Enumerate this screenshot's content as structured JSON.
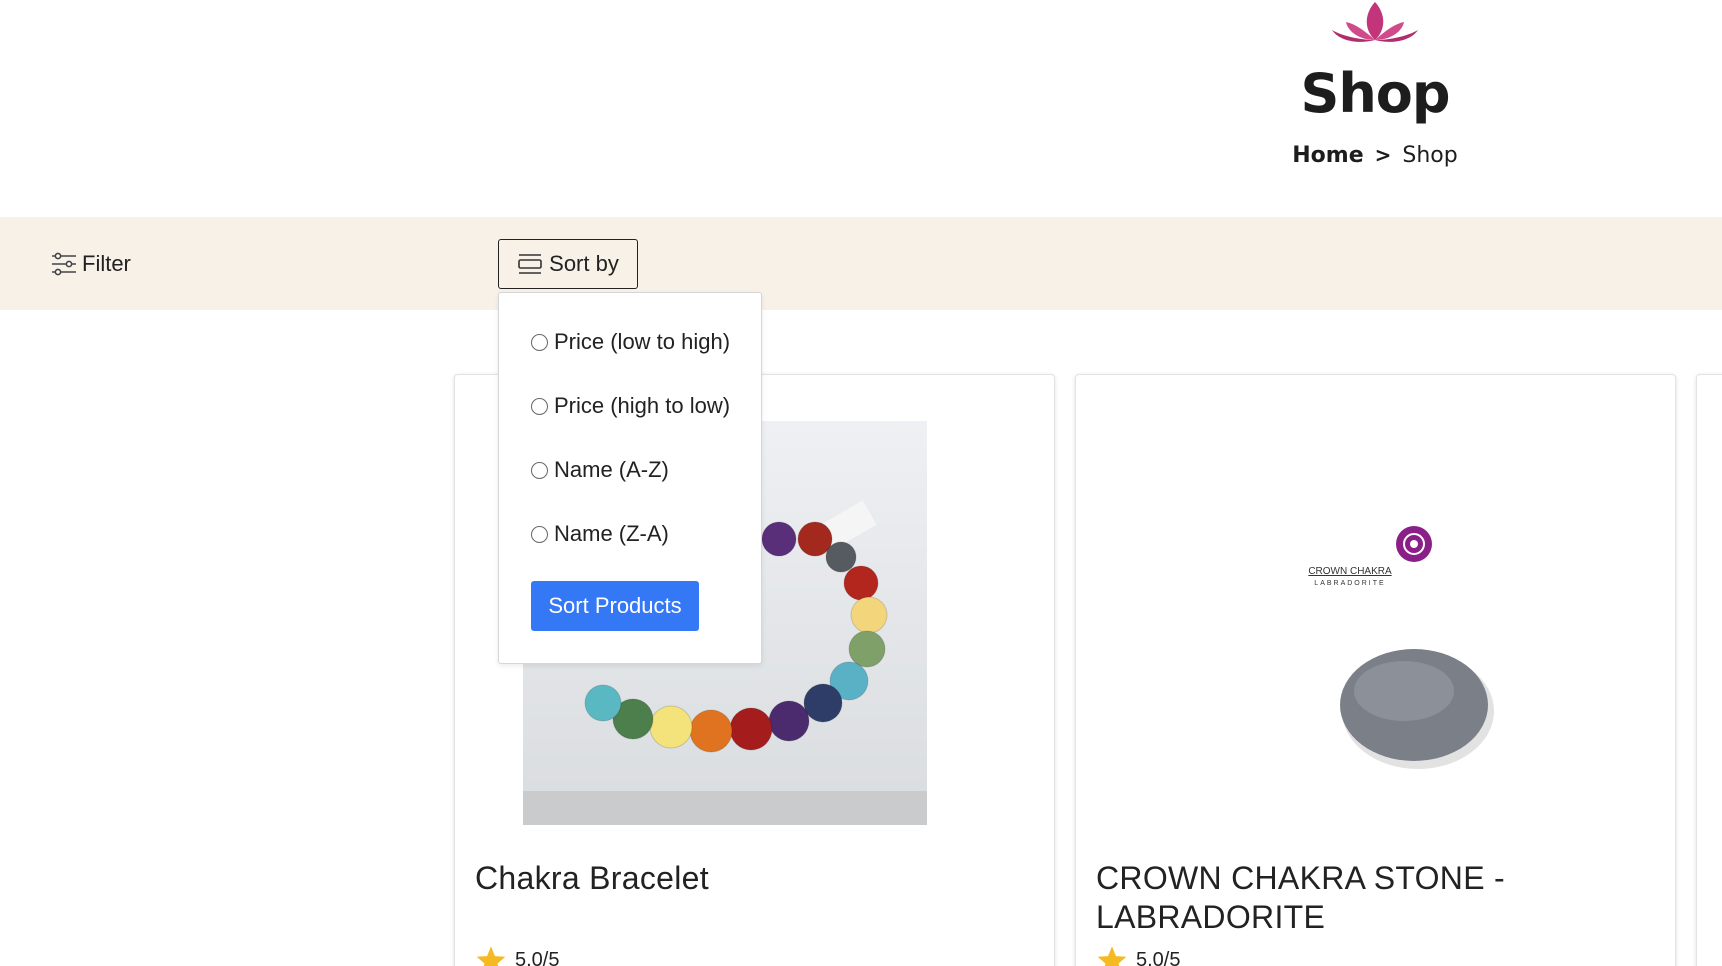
{
  "header": {
    "logo_icon": "lotus-icon",
    "title": "Shop",
    "breadcrumb": {
      "home": "Home",
      "separator": ">",
      "current": "Shop"
    }
  },
  "toolbar": {
    "filter_label": "Filter",
    "filter_icon": "sliders-icon",
    "sort_label": "Sort by",
    "sort_icon": "sort-icon"
  },
  "sort_menu": {
    "options": [
      "Price (low to high)",
      "Price (high to low)",
      "Name (A-Z)",
      "Name (Z-A)"
    ],
    "submit_label": "Sort Products"
  },
  "products": [
    {
      "name": "Chakra Bracelet",
      "rating": "5.0/5"
    },
    {
      "name": "CROWN CHAKRA STONE - LABRADORITE",
      "rating": "5.0/5",
      "image_text": {
        "brand": "CROWN CHAKRA",
        "sub": "LABRADORITE"
      }
    }
  ],
  "colors": {
    "toolbar_bg": "#f7f1e8",
    "accent_button": "#3478f6",
    "star": "#f5b921",
    "lotus": "#c2357a"
  }
}
